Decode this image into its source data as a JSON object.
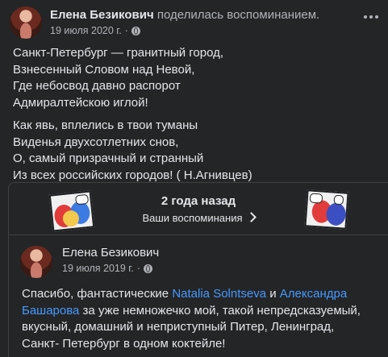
{
  "post": {
    "author": "Елена Безикович",
    "action": "поделилась воспоминанием.",
    "date": "19 июля 2020 г.",
    "separator": "·",
    "privacy_icon": "globe-icon",
    "menu_icon": "more-options-icon",
    "poem_lines": [
      "Санкт-Петербург — гранитный город,",
      "Взнесенный Словом над Невой,",
      "Где небосвод давно распорот",
      "Адмиралтейскою иглой!"
    ],
    "poem_lines_2": [
      "Как явь, вплелись в твои туманы",
      "Виденья двухсотлетних снов,",
      "О, самый призрачный и странный",
      "Из всех российских городов! ( Н.Агнивцев)"
    ]
  },
  "memory": {
    "title": "2 года назад",
    "subtitle": "Ваши воспоминания",
    "left_illustration_icon": "friends-illustration-icon",
    "right_illustration_icon": "friends-conversation-illustration-icon"
  },
  "inner_post": {
    "author": "Елена Безикович",
    "date": "19 июля 2019 г.",
    "separator": "·",
    "privacy_icon": "globe-icon",
    "text_1": "Спасибо, фантастические ",
    "mention_1": "Natalia Solntseva",
    "text_2": " и ",
    "mention_2a": "Александра",
    "mention_2b": "Башарова",
    "text_3": " за уже немножечко мой, такой непредсказуемый,",
    "text_4": "вкусный, домашний и неприступный  Питер, Ленинград,",
    "text_5": "Санкт- Петербург  в одном коктейле!"
  },
  "colors": {
    "background": "#242526",
    "text": "#e4e6eb",
    "secondary_text": "#b0b3b8",
    "link": "#4599ff"
  }
}
